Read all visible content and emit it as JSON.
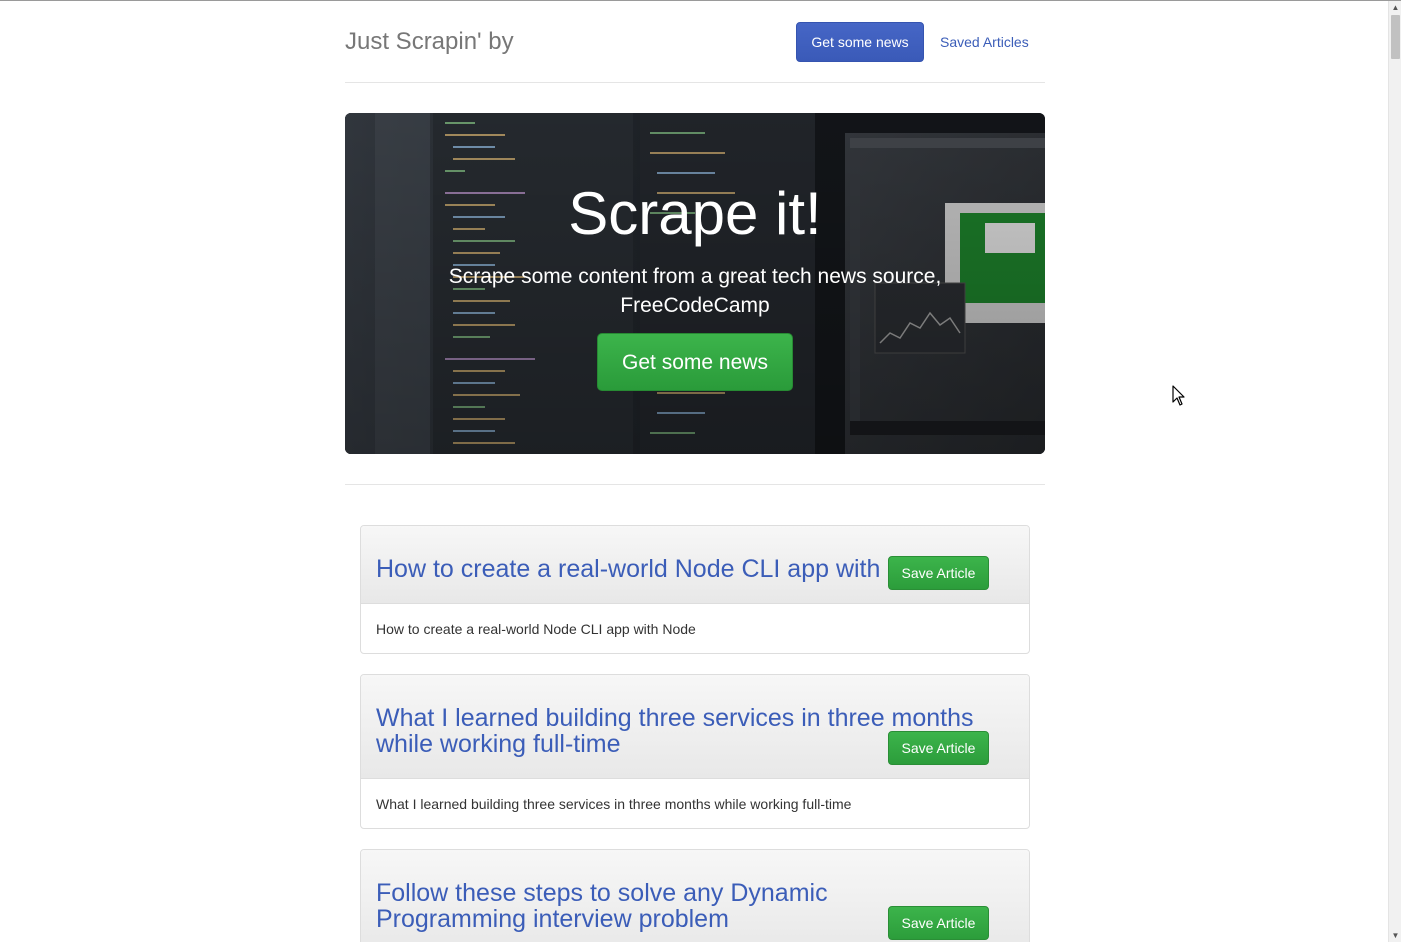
{
  "header": {
    "brand": "Just Scrapin' by",
    "primary_button": "Get some news",
    "saved_link": "Saved Articles"
  },
  "hero": {
    "title": "Scrape it!",
    "subtitle": "Scrape some content from a great tech news source, FreeCodeCamp",
    "button": "Get some news"
  },
  "articles": [
    {
      "title": "How to create a real-world Node CLI app with Node",
      "summary": "How to create a real-world Node CLI app with Node",
      "save_label": "Save Article"
    },
    {
      "title": "What I learned building three services in three months while working full-time",
      "summary": "What I learned building three services in three months while working full-time",
      "save_label": "Save Article"
    },
    {
      "title": "Follow these steps to solve any Dynamic Programming interview problem",
      "save_label": "Save Article"
    }
  ],
  "colors": {
    "primary": "#3f5fbf",
    "success": "#2ea043",
    "link": "#3b5db8"
  },
  "icons": {
    "cursor": "pointer-cursor-icon",
    "scroll_up": "scroll-up-arrow-icon",
    "scroll_down": "scroll-down-arrow-icon"
  }
}
